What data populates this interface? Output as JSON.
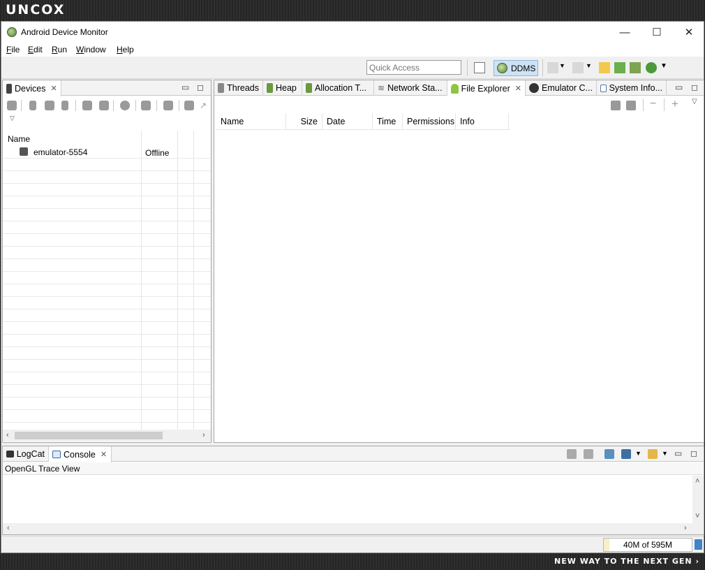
{
  "brand": "UNCOX",
  "tagline": "NEW WAY TO THE NEXT GEN ›",
  "window": {
    "title": "Android Device Monitor",
    "minimize": "—",
    "maximize": "☐",
    "close": "✕"
  },
  "menu": [
    {
      "ul": "F",
      "rest": "ile"
    },
    {
      "ul": "E",
      "rest": "dit"
    },
    {
      "ul": "R",
      "rest": "un"
    },
    {
      "ul": "W",
      "rest": "indow"
    },
    {
      "ul": "H",
      "rest": "elp"
    }
  ],
  "toolbar": {
    "quick_access_placeholder": "Quick Access",
    "perspective": "DDMS"
  },
  "devices": {
    "tab": "Devices",
    "column_name": "Name",
    "rows": [
      {
        "name": "emulator-5554",
        "status": "Offline"
      }
    ]
  },
  "right_tabs": [
    {
      "label": "Threads"
    },
    {
      "label": "Heap"
    },
    {
      "label": "Allocation T..."
    },
    {
      "label": "Network Sta..."
    },
    {
      "label": "File Explorer"
    },
    {
      "label": "Emulator C..."
    },
    {
      "label": "System Info..."
    }
  ],
  "file_explorer": {
    "columns": [
      "Name",
      "Size",
      "Date",
      "Time",
      "Permissions",
      "Info"
    ]
  },
  "bottom_tabs": [
    {
      "label": "LogCat"
    },
    {
      "label": "Console"
    }
  ],
  "console": {
    "title": "OpenGL Trace View"
  },
  "status": {
    "heap": "40M of 595M",
    "heap_used_fraction": 0.067
  },
  "colors": {
    "active_perspective": "#cde3f5",
    "android_green": "#8dc63f"
  }
}
